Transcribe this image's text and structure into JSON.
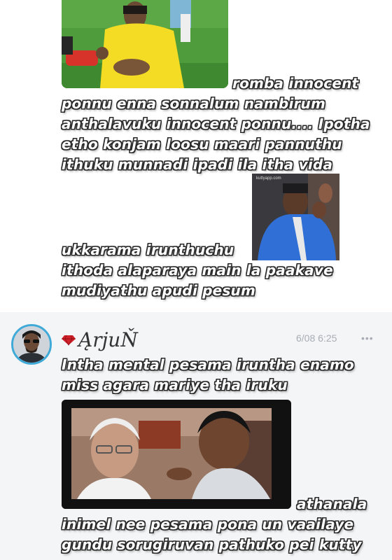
{
  "post1": {
    "lines": [
      "romba innocent",
      "ponnu enna sonnalum nambirum",
      "anthalavuku innocent ponnu.... Ipotha",
      "etho konjam loosu maari pannuthu",
      "ithuku munnadi ipadi ila itha vida",
      "ukkarama irunthuchu",
      "ithoda alaparaya main la paakave",
      "mudiyathu apudi pesum"
    ],
    "gif2_watermark": "kuttyapp.com"
  },
  "post2": {
    "username": "ĄrjuŇ",
    "timestamp": "6/08 6:25",
    "more_label": "•••",
    "lines": [
      "Intha mental pesama iruntha enamo",
      "miss agara mariye tha iruku",
      "athanala",
      "inimel nee pesama pona un vaailaye",
      "gundu sorugiruvan pathuko pei kutty"
    ]
  },
  "colors": {
    "avatar_ring": "#3fa9d8",
    "gem": "#d0202a",
    "post2_bg": "#f4f5f7"
  },
  "icons": [
    "gem-icon",
    "more-icon"
  ]
}
